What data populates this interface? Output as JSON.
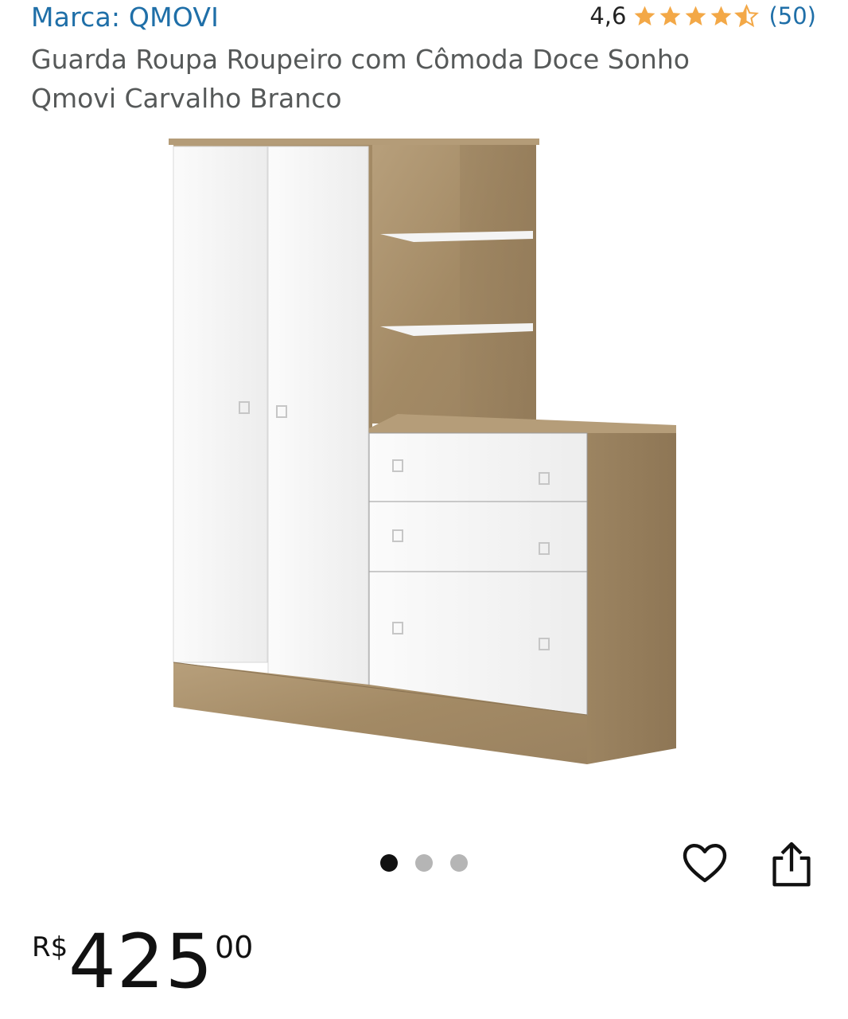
{
  "brand": {
    "label": "Marca: QMOVI"
  },
  "rating": {
    "value": "4,6",
    "stars": 4.6,
    "count": "(50)",
    "star_color": "#f3a847"
  },
  "product": {
    "title": "Guarda Roupa Roupeiro com Cômoda Doce Sonho Qmovi Carvalho Branco",
    "image_icon": "wardrobe-product-image"
  },
  "carousel": {
    "dots": 3,
    "active_index": 0
  },
  "actions": {
    "wishlist_icon": "heart-icon",
    "share_icon": "share-icon"
  },
  "price": {
    "currency": "R$",
    "whole": "425",
    "cents": "00"
  },
  "colors": {
    "link": "#1f6fa8",
    "wood": "#a58d6a",
    "white": "#f7f7f7"
  }
}
